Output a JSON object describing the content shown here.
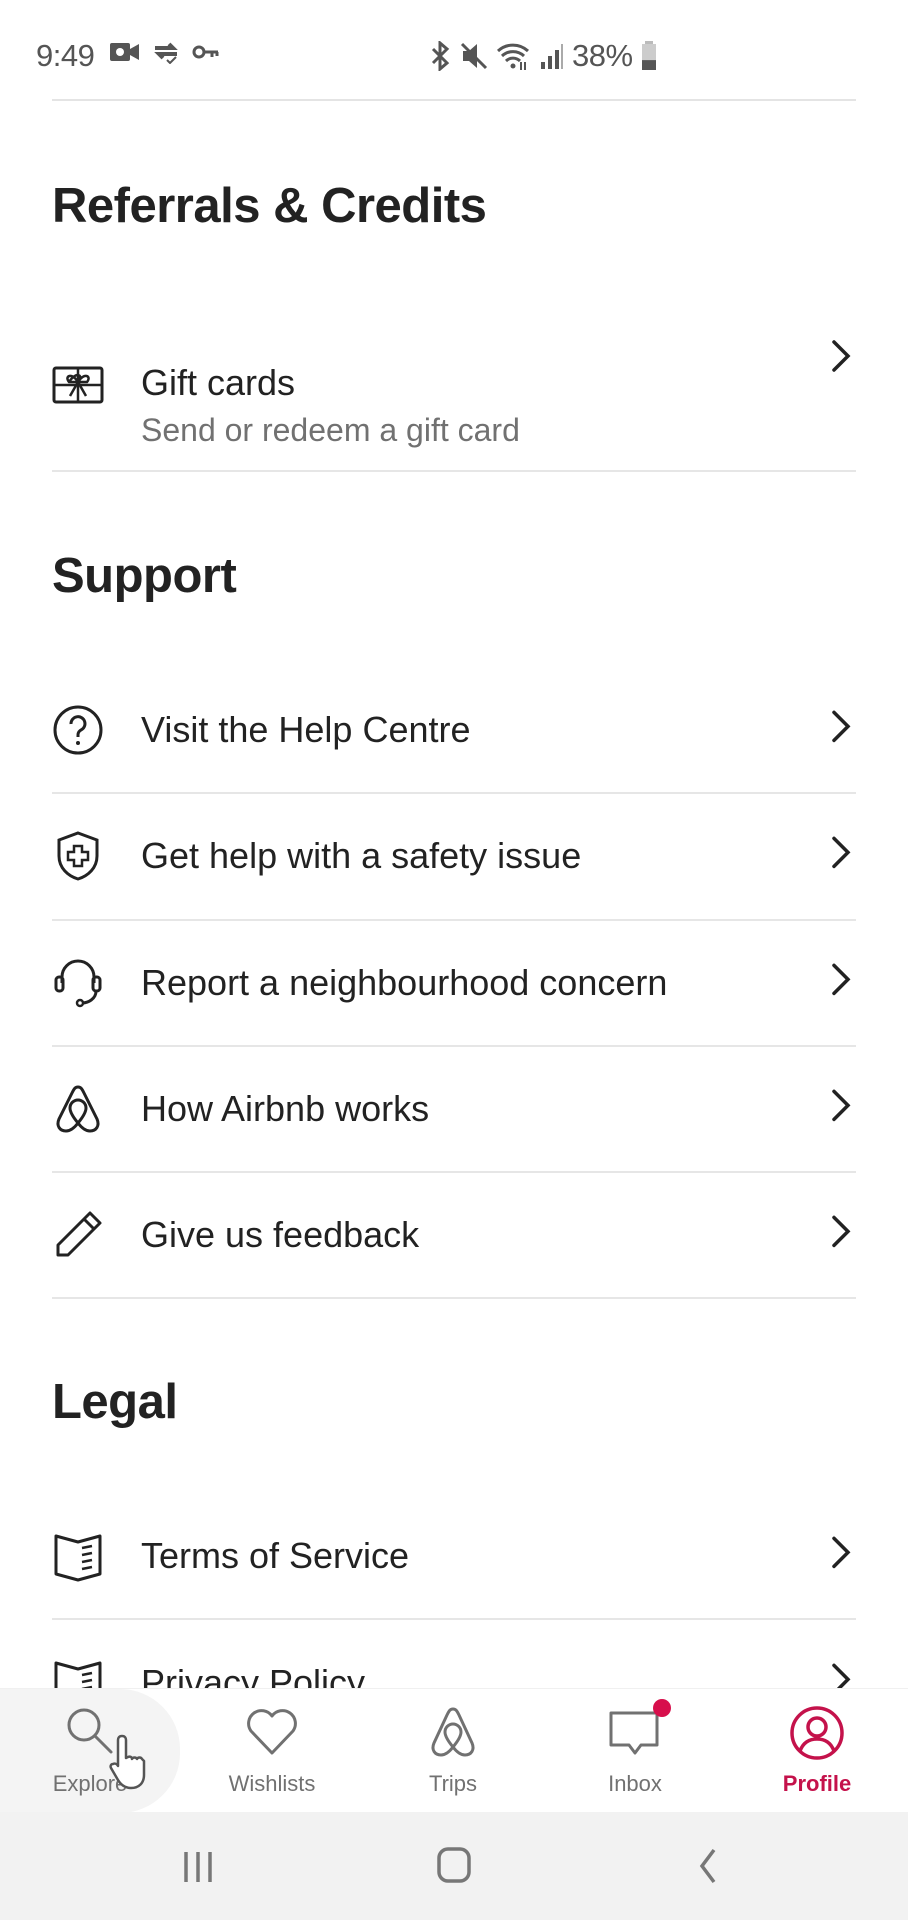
{
  "status_bar": {
    "time": "9:49",
    "left_icons": [
      "video-camera-icon",
      "sync-check-icon",
      "key-icon"
    ],
    "right_icons": [
      "bluetooth-icon",
      "mute-icon",
      "wifi-icon",
      "signal-icon"
    ],
    "battery_percent": "38%",
    "battery_level": 0.38
  },
  "sections": {
    "referrals": {
      "title": "Referrals & Credits",
      "items": [
        {
          "label": "Gift cards",
          "subtitle": "Send or redeem a gift card",
          "icon": "gift-card-icon"
        }
      ]
    },
    "support": {
      "title": "Support",
      "items": [
        {
          "label": "Visit the Help Centre",
          "icon": "help-circle-icon"
        },
        {
          "label": "Get help with a safety issue",
          "icon": "safety-shield-icon"
        },
        {
          "label": "Report a neighbourhood concern",
          "icon": "headset-icon"
        },
        {
          "label": "How Airbnb works",
          "icon": "airbnb-logo-icon"
        },
        {
          "label": "Give us feedback",
          "icon": "pencil-icon"
        }
      ]
    },
    "legal": {
      "title": "Legal",
      "items": [
        {
          "label": "Terms of Service",
          "icon": "book-icon"
        },
        {
          "label": "Privacy Policy",
          "icon": "book-icon"
        }
      ]
    }
  },
  "tab_bar": {
    "active_color": "#c4124b",
    "inactive_color": "#717171",
    "badge_color": "#d70f4c",
    "tabs": [
      {
        "label": "Explore",
        "icon": "search-icon",
        "state": "pressed"
      },
      {
        "label": "Wishlists",
        "icon": "heart-icon"
      },
      {
        "label": "Trips",
        "icon": "airbnb-logo-icon"
      },
      {
        "label": "Inbox",
        "icon": "message-icon",
        "has_badge": true
      },
      {
        "label": "Profile",
        "icon": "profile-icon",
        "state": "active"
      }
    ]
  },
  "system_nav": [
    "recent-apps-icon",
    "home-icon",
    "back-icon"
  ]
}
